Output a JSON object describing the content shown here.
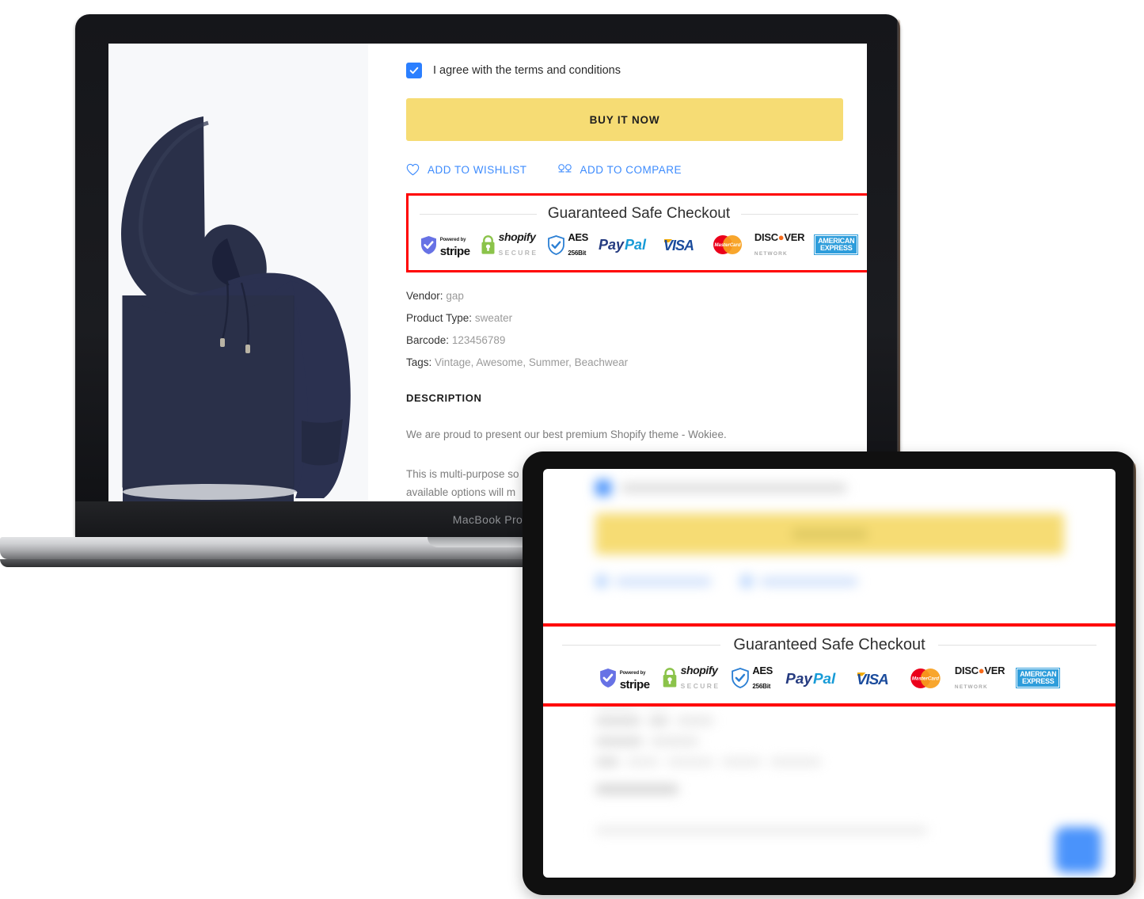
{
  "device_laptop": {
    "name": "MacBook Pro",
    "bezel_label": "MacBook Pro"
  },
  "product": {
    "terms_label": "I agree with the terms and conditions",
    "buy_button": "BUY IT NOW",
    "wishlist_label": "ADD TO WISHLIST",
    "compare_label": "ADD TO COMPARE",
    "meta": {
      "vendor_label": "Vendor:",
      "vendor_value": "gap",
      "type_label": "Product Type:",
      "type_value": "sweater",
      "barcode_label": "Barcode:",
      "barcode_value": "123456789",
      "tags_label": "Tags:",
      "tags_value": "Vintage, Awesome, Summer, Beachwear"
    },
    "description_heading": "DESCRIPTION",
    "description_p1": "We are proud to present our best premium Shopify theme - Wokiee.",
    "description_p2": "This is multi-purpose so",
    "description_p3": "available options will m"
  },
  "safe_checkout": {
    "title": "Guaranteed Safe Checkout",
    "border_color": "#ff0000",
    "badges": [
      {
        "name": "stripe",
        "top": "Powered by",
        "main": "stripe",
        "color": "#6772e5"
      },
      {
        "name": "shopify-secure",
        "main": "shopify",
        "sub": "SECURE",
        "color": "#8bc34a"
      },
      {
        "name": "aes-256bit",
        "main": "AES",
        "sub": "256Bit",
        "color": "#2b7fd4"
      },
      {
        "name": "paypal",
        "main": "PayPal",
        "color1": "#253b80",
        "color2": "#179bd7"
      },
      {
        "name": "visa",
        "main": "VISA",
        "color": "#1a4b9c"
      },
      {
        "name": "mastercard",
        "main": "MasterCard",
        "color1": "#eb001b",
        "color2": "#f79e1b"
      },
      {
        "name": "discover",
        "main": "DISCOVER",
        "sub": "NETWORK",
        "color": "#f76b1c"
      },
      {
        "name": "american-express",
        "line1": "AMERICAN",
        "line2": "EXPRESS",
        "color": "#2e9ddb"
      }
    ]
  },
  "theme": {
    "buy_button_color": "#f6dc74",
    "link_color": "#3d8bfd",
    "checkbox_color": "#2b7fff",
    "gallery_bg": "#f7f8fa",
    "product_color": "#2a3049"
  }
}
